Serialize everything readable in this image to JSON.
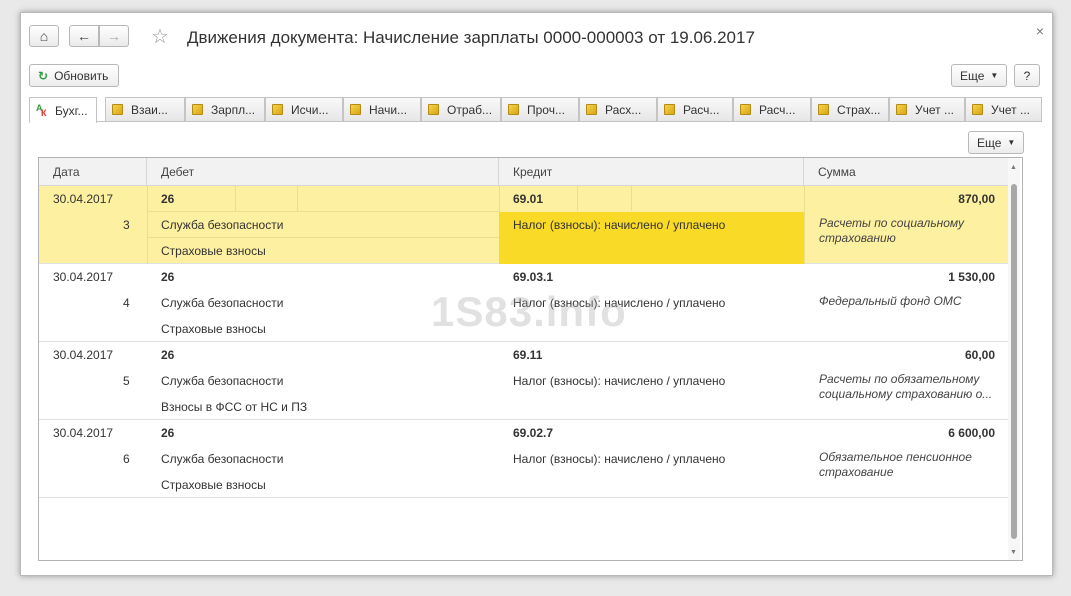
{
  "window": {
    "title": "Движения документа: Начисление зарплаты 0000-000003 от 19.06.2017",
    "close_icon": "×"
  },
  "toolbar": {
    "home_icon": "⌂",
    "back_icon": "←",
    "forward_icon": "→",
    "star_icon": "☆",
    "refresh_label": "Обновить",
    "more_label": "Еще",
    "help_label": "?"
  },
  "tabs": [
    {
      "label": "Бухг..."
    },
    {
      "label": "Взаи..."
    },
    {
      "label": "Зарпл..."
    },
    {
      "label": "Исчи..."
    },
    {
      "label": "Начи..."
    },
    {
      "label": "Отраб..."
    },
    {
      "label": "Проч..."
    },
    {
      "label": "Расх..."
    },
    {
      "label": "Расч..."
    },
    {
      "label": "Расч..."
    },
    {
      "label": "Страх..."
    },
    {
      "label": "Учет ..."
    },
    {
      "label": "Учет ..."
    }
  ],
  "table": {
    "more_label": "Еще",
    "columns": {
      "date": "Дата",
      "debit": "Дебет",
      "credit": "Кредит",
      "sum": "Сумма"
    },
    "rows": [
      {
        "date": "30.04.2017",
        "num": "3",
        "debit_account": "26",
        "debit_sub1": "Служба безопасности",
        "debit_sub2": "Страховые взносы",
        "credit_account": "69.01",
        "credit_sub1": "Налог (взносы): начислено / уплачено",
        "sum": "870,00",
        "content": "Расчеты по социальному страхованию"
      },
      {
        "date": "30.04.2017",
        "num": "4",
        "debit_account": "26",
        "debit_sub1": "Служба безопасности",
        "debit_sub2": "Страховые взносы",
        "credit_account": "69.03.1",
        "credit_sub1": "Налог (взносы): начислено / уплачено",
        "sum": "1 530,00",
        "content": "Федеральный фонд ОМС"
      },
      {
        "date": "30.04.2017",
        "num": "5",
        "debit_account": "26",
        "debit_sub1": "Служба безопасности",
        "debit_sub2": "Взносы в ФСС от НС и ПЗ",
        "credit_account": "69.11",
        "credit_sub1": "Налог (взносы): начислено / уплачено",
        "sum": "60,00",
        "content": "Расчеты по обязательному социальному страхованию о..."
      },
      {
        "date": "30.04.2017",
        "num": "6",
        "debit_account": "26",
        "debit_sub1": "Служба безопасности",
        "debit_sub2": "Страховые взносы",
        "credit_account": "69.02.7",
        "credit_sub1": "Налог (взносы): начислено / уплачено",
        "sum": "6 600,00",
        "content": "Обязательное пенсионное страхование"
      }
    ]
  },
  "watermark": "1S83.info",
  "colors": {
    "selected_row": "#fdf0a0",
    "selected_cell": "#f9da26",
    "window_bg": "#ffffff"
  }
}
